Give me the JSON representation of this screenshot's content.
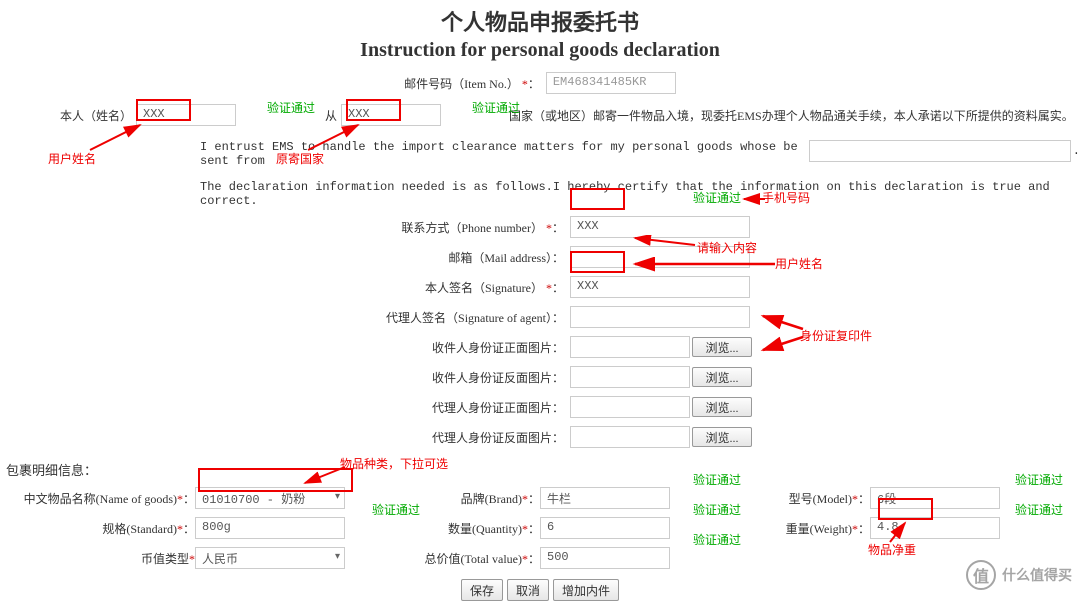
{
  "title_cn": "个人物品申报委托书",
  "title_en": "Instruction for personal goods declaration",
  "item_no": {
    "label": "邮件号码（Item No.）",
    "value": "EM468341485KR"
  },
  "name_prefix": "本人（姓名）",
  "name_value": "XXX",
  "from_word": "从",
  "country_value": "XXX",
  "sentence_tail": "国家（或地区）邮寄一件物品入境，现委托EMS办理个人物品通关手续，本人承诺以下所提供的资料属实。",
  "english_line": "I entrust EMS to handle the import clearance matters for my personal goods whose be sent from",
  "english_line2": "The declaration information needed is as follows.I hereby certify that the information on this declaration is true and correct.",
  "phone": {
    "label": "联系方式（Phone number）",
    "value": "XXX"
  },
  "mail": {
    "label": "邮箱（Mail address）：",
    "value": ""
  },
  "signature": {
    "label": "本人签名（Signature）",
    "value": "XXX"
  },
  "agent_sig": {
    "label": "代理人签名（Signature of agent）：",
    "value": ""
  },
  "id_front": {
    "label": "收件人身份证正面图片："
  },
  "id_back": {
    "label": "收件人身份证反面图片："
  },
  "agent_id_front": {
    "label": "代理人身份证正面图片："
  },
  "agent_id_back": {
    "label": "代理人身份证反面图片："
  },
  "browse_label": "浏览...",
  "section_header": "包裹明细信息：",
  "goods_name": {
    "label": "中文物品名称(Name of goods)",
    "value": "01010700 - 奶粉"
  },
  "brand": {
    "label": "品牌(Brand)",
    "value": "牛栏"
  },
  "model": {
    "label": "型号(Model)",
    "value": "6段"
  },
  "standard": {
    "label": "规格(Standard)",
    "value": "800g"
  },
  "quantity": {
    "label": "数量(Quantity)",
    "value": "6"
  },
  "weight": {
    "label": "重量(Weight)",
    "value": "4.8"
  },
  "currency": {
    "label": "币值类型",
    "value": "人民币"
  },
  "total": {
    "label": "总价值(Total value)",
    "value": "500"
  },
  "buttons": {
    "save": "保存",
    "cancel": "取消",
    "add": "增加内件"
  },
  "validate_ok": "验证通过",
  "annot": {
    "user_name": "用户姓名",
    "origin_country": "原寄国家",
    "phone_no": "手机号码",
    "please_input": "请输入内容",
    "user_name2": "用户姓名",
    "id_copy": "身份证复印件",
    "goods_category": "物品种类，下拉可选",
    "net_weight": "物品净重"
  },
  "watermark": "什么值得买"
}
